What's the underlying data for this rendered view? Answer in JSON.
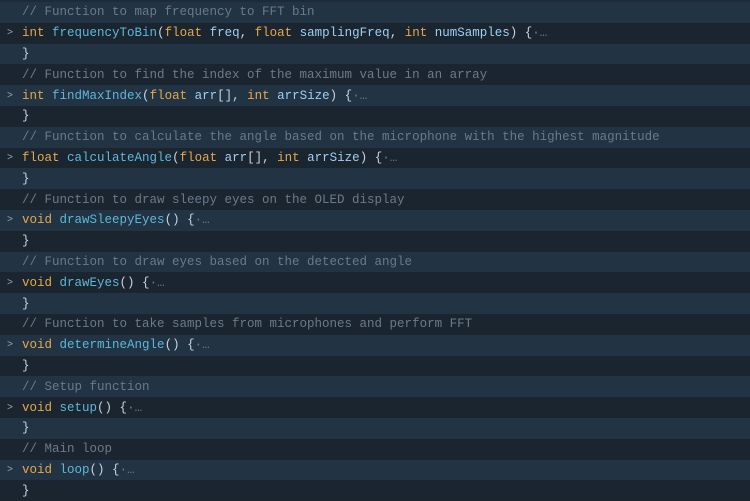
{
  "lines": [
    {
      "stripe": "light",
      "gutter": "",
      "tokens": [
        {
          "cls": "tk-comment",
          "t": "// Function to map frequency to FFT bin"
        }
      ]
    },
    {
      "stripe": "dark",
      "gutter": ">",
      "tokens": [
        {
          "cls": "tk-type",
          "t": "int"
        },
        {
          "cls": "tk-punct",
          "t": " "
        },
        {
          "cls": "tk-fn",
          "t": "frequencyToBin"
        },
        {
          "cls": "tk-punct",
          "t": "("
        },
        {
          "cls": "tk-type",
          "t": "float"
        },
        {
          "cls": "tk-punct",
          "t": " "
        },
        {
          "cls": "tk-param",
          "t": "freq"
        },
        {
          "cls": "tk-punct",
          "t": ", "
        },
        {
          "cls": "tk-type",
          "t": "float"
        },
        {
          "cls": "tk-punct",
          "t": " "
        },
        {
          "cls": "tk-param",
          "t": "samplingFreq"
        },
        {
          "cls": "tk-punct",
          "t": ", "
        },
        {
          "cls": "tk-type",
          "t": "int"
        },
        {
          "cls": "tk-punct",
          "t": " "
        },
        {
          "cls": "tk-param",
          "t": "numSamples"
        },
        {
          "cls": "tk-punct",
          "t": ") {"
        },
        {
          "cls": "tk-fold",
          "t": "·…"
        }
      ]
    },
    {
      "stripe": "light",
      "gutter": "",
      "tokens": [
        {
          "cls": "tk-punct",
          "t": "}"
        }
      ]
    },
    {
      "stripe": "dark",
      "gutter": "",
      "tokens": [
        {
          "cls": "tk-comment",
          "t": "// Function to find the index of the maximum value in an array"
        }
      ]
    },
    {
      "stripe": "light",
      "gutter": ">",
      "tokens": [
        {
          "cls": "tk-type",
          "t": "int"
        },
        {
          "cls": "tk-punct",
          "t": " "
        },
        {
          "cls": "tk-fn",
          "t": "findMaxIndex"
        },
        {
          "cls": "tk-punct",
          "t": "("
        },
        {
          "cls": "tk-type",
          "t": "float"
        },
        {
          "cls": "tk-punct",
          "t": " "
        },
        {
          "cls": "tk-param",
          "t": "arr"
        },
        {
          "cls": "tk-punct",
          "t": "[], "
        },
        {
          "cls": "tk-type",
          "t": "int"
        },
        {
          "cls": "tk-punct",
          "t": " "
        },
        {
          "cls": "tk-param",
          "t": "arrSize"
        },
        {
          "cls": "tk-punct",
          "t": ") {"
        },
        {
          "cls": "tk-fold",
          "t": "·…"
        }
      ]
    },
    {
      "stripe": "dark",
      "gutter": "",
      "tokens": [
        {
          "cls": "tk-punct",
          "t": "}"
        }
      ]
    },
    {
      "stripe": "light",
      "gutter": "",
      "tokens": [
        {
          "cls": "tk-comment",
          "t": "// Function to calculate the angle based on the microphone with the highest magnitude"
        }
      ]
    },
    {
      "stripe": "dark",
      "gutter": ">",
      "tokens": [
        {
          "cls": "tk-type",
          "t": "float"
        },
        {
          "cls": "tk-punct",
          "t": " "
        },
        {
          "cls": "tk-fn",
          "t": "calculateAngle"
        },
        {
          "cls": "tk-punct",
          "t": "("
        },
        {
          "cls": "tk-type",
          "t": "float"
        },
        {
          "cls": "tk-punct",
          "t": " "
        },
        {
          "cls": "tk-param",
          "t": "arr"
        },
        {
          "cls": "tk-punct",
          "t": "[], "
        },
        {
          "cls": "tk-type",
          "t": "int"
        },
        {
          "cls": "tk-punct",
          "t": " "
        },
        {
          "cls": "tk-param",
          "t": "arrSize"
        },
        {
          "cls": "tk-punct",
          "t": ") {"
        },
        {
          "cls": "tk-fold",
          "t": "·…"
        }
      ]
    },
    {
      "stripe": "light",
      "gutter": "",
      "tokens": [
        {
          "cls": "tk-punct",
          "t": "}"
        }
      ]
    },
    {
      "stripe": "dark",
      "gutter": "",
      "tokens": [
        {
          "cls": "tk-comment",
          "t": "// Function to draw sleepy eyes on the OLED display"
        }
      ]
    },
    {
      "stripe": "light",
      "gutter": ">",
      "tokens": [
        {
          "cls": "tk-kw",
          "t": "void"
        },
        {
          "cls": "tk-punct",
          "t": " "
        },
        {
          "cls": "tk-fn",
          "t": "drawSleepyEyes"
        },
        {
          "cls": "tk-punct",
          "t": "() {"
        },
        {
          "cls": "tk-fold",
          "t": "·…"
        }
      ]
    },
    {
      "stripe": "dark",
      "gutter": "",
      "tokens": [
        {
          "cls": "tk-punct",
          "t": "}"
        }
      ]
    },
    {
      "stripe": "light",
      "gutter": "",
      "tokens": [
        {
          "cls": "tk-comment",
          "t": "// Function to draw eyes based on the detected angle"
        }
      ]
    },
    {
      "stripe": "dark",
      "gutter": ">",
      "tokens": [
        {
          "cls": "tk-kw",
          "t": "void"
        },
        {
          "cls": "tk-punct",
          "t": " "
        },
        {
          "cls": "tk-fn",
          "t": "drawEyes"
        },
        {
          "cls": "tk-punct",
          "t": "() {"
        },
        {
          "cls": "tk-fold",
          "t": "·…"
        }
      ]
    },
    {
      "stripe": "light",
      "gutter": "",
      "tokens": [
        {
          "cls": "tk-punct",
          "t": "}"
        }
      ]
    },
    {
      "stripe": "dark",
      "gutter": "",
      "tokens": [
        {
          "cls": "tk-comment",
          "t": "// Function to take samples from microphones and perform FFT"
        }
      ]
    },
    {
      "stripe": "light",
      "gutter": ">",
      "tokens": [
        {
          "cls": "tk-kw",
          "t": "void"
        },
        {
          "cls": "tk-punct",
          "t": " "
        },
        {
          "cls": "tk-fn",
          "t": "determineAngle"
        },
        {
          "cls": "tk-punct",
          "t": "() {"
        },
        {
          "cls": "tk-fold",
          "t": "·…"
        }
      ]
    },
    {
      "stripe": "dark",
      "gutter": "",
      "tokens": [
        {
          "cls": "tk-punct",
          "t": "}"
        }
      ]
    },
    {
      "stripe": "light",
      "gutter": "",
      "tokens": [
        {
          "cls": "tk-comment",
          "t": "// Setup function"
        }
      ]
    },
    {
      "stripe": "dark",
      "gutter": ">",
      "tokens": [
        {
          "cls": "tk-kw",
          "t": "void"
        },
        {
          "cls": "tk-punct",
          "t": " "
        },
        {
          "cls": "tk-fn",
          "t": "setup"
        },
        {
          "cls": "tk-punct",
          "t": "() {"
        },
        {
          "cls": "tk-fold",
          "t": "·…"
        }
      ]
    },
    {
      "stripe": "light",
      "gutter": "",
      "tokens": [
        {
          "cls": "tk-punct",
          "t": "}"
        }
      ]
    },
    {
      "stripe": "dark",
      "gutter": "",
      "tokens": [
        {
          "cls": "tk-comment",
          "t": "// Main loop"
        }
      ]
    },
    {
      "stripe": "light",
      "gutter": ">",
      "tokens": [
        {
          "cls": "tk-kw",
          "t": "void"
        },
        {
          "cls": "tk-punct",
          "t": " "
        },
        {
          "cls": "tk-fn",
          "t": "loop"
        },
        {
          "cls": "tk-punct",
          "t": "() {"
        },
        {
          "cls": "tk-fold",
          "t": "·…"
        }
      ]
    },
    {
      "stripe": "dark",
      "gutter": "",
      "tokens": [
        {
          "cls": "tk-punct",
          "t": "}"
        }
      ]
    }
  ]
}
